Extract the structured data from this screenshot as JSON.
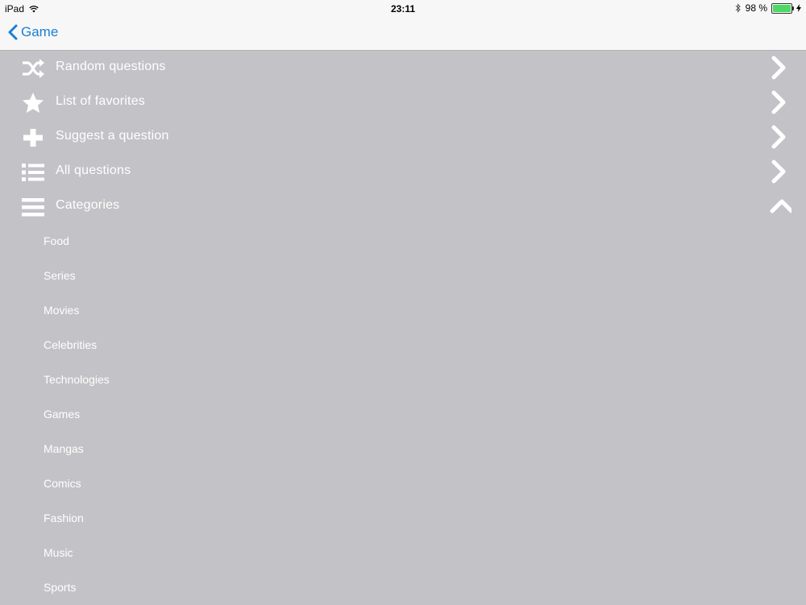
{
  "status_bar": {
    "device": "iPad",
    "time": "23:11",
    "battery_text": "98 %",
    "battery_level": 0.98
  },
  "nav": {
    "back_label": "Game"
  },
  "menu": {
    "items": [
      {
        "label": "Random questions",
        "icon": "shuffle-icon"
      },
      {
        "label": "List of favorites",
        "icon": "star-icon"
      },
      {
        "label": "Suggest a question",
        "icon": "plus-icon"
      },
      {
        "label": "All questions",
        "icon": "list-icon"
      },
      {
        "label": "Categories",
        "icon": "menu-icon"
      }
    ],
    "categories": [
      {
        "label": "Food"
      },
      {
        "label": "Series"
      },
      {
        "label": "Movies"
      },
      {
        "label": "Celebrities"
      },
      {
        "label": "Technologies"
      },
      {
        "label": "Games"
      },
      {
        "label": "Mangas"
      },
      {
        "label": "Comics"
      },
      {
        "label": "Fashion"
      },
      {
        "label": "Music"
      },
      {
        "label": "Sports"
      }
    ]
  },
  "colors": {
    "background": "#c3c2c6",
    "accent": "#1a7fd4",
    "battery": "#4cd964"
  }
}
